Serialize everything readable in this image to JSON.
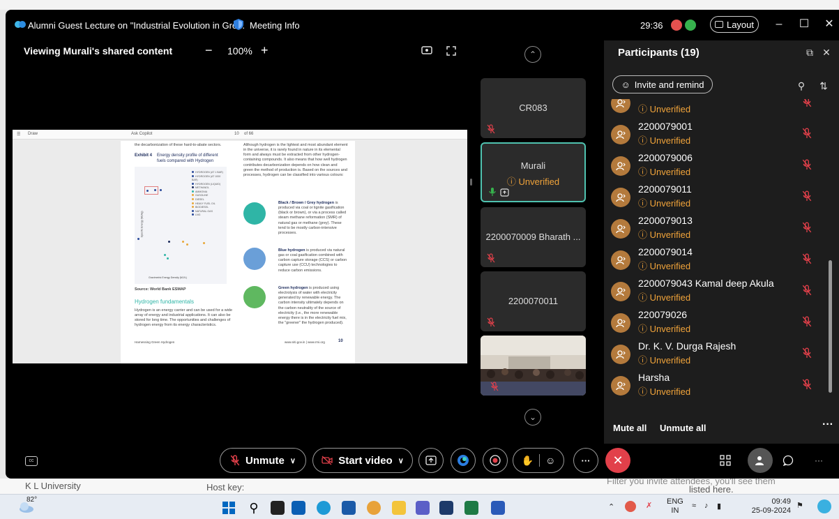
{
  "background": {
    "org_text": "K L University",
    "host_key": "Host key:",
    "listed": "listed here.",
    "filter": "Filter you invite attendees, you'll see them"
  },
  "titlebar": {
    "title": "Alumni Guest Lecture on \"Industrial Evolution in Gre...",
    "meeting_info": "Meeting Info",
    "timer": "29:36",
    "layout_label": "Layout"
  },
  "share": {
    "viewing": "Viewing Murali's shared content",
    "zoom_minus": "−",
    "zoom": "100%",
    "zoom_plus": "+"
  },
  "document": {
    "toolbar": {
      "draw": "Draw",
      "ask": "Ask Copilot",
      "page": "10",
      "of": "of 66"
    },
    "exhibit_label": "Exhibit 4",
    "exhibit_title": "Energy density profile of different fuels compared with Hydrogen",
    "source": "Source: World Bank ESMAP",
    "section_heading": "Hydrogen fundamentals",
    "para1": "Hydrogen is an energy carrier and can be used for a wide array of energy and industrial applications. It can also be stored for long time. The opportunities and challenges of hydrogen energy from its energy characteristics.",
    "intro": "Although hydrogen is the lightest and most abundant element in the universe, it is rarely found in nature in its elemental form and always must be extracted from other hydrogen-containing compounds. It also means that how well hydrogen contributes decarbonization depends on how clean and green the method of production is. Based on the sources and processes, hydrogen can be classified into various colours:",
    "black_title": "Black / Brown / Grey hydrogen",
    "black_text": "is produced via coal or lignite gasification (black or brown), or via a process called steam methane reformation (SMR) of natural gas or methane (grey). These tend to be mostly carbon-intensive processes.",
    "blue_title": "Blue hydrogen",
    "blue_text": "is produced via natural gas or coal gasification combined with carbon capture storage (CCS) or carbon capture use (CCU) technologies to reduce carbon emissions.",
    "green_title": "Green hydrogen",
    "green_text": "is produced using electrolysis of water with electricity generated by renewable energy. The carbon intensity ultimately depends on the carbon neutrality of the source of electricity (i.e., the more renewable energy there is in the electricity fuel mix, the \"greener\" the hydrogen produced).",
    "footer_left": "Harnessing Green Hydrogen",
    "footer_right": "www.niti.gov.in | www.rmi.org",
    "footer_page": "10",
    "top_text": "the decarbonization of these hard-to-abate sectors.",
    "legend": [
      "HYDROGEN (AT 1 BAR)",
      "HYDROGEN (AT 1000 BAR)",
      "HYDROGEN (LIQUID)",
      "METHANOL",
      "AMMONIA",
      "GASOLINE",
      "DIESEL",
      "HEAVY FUEL OIL",
      "BIODIESEL",
      "NATURAL GAS",
      "LNG"
    ],
    "xaxis": "Gravimetric Energy Density (MJ/L)",
    "yaxis": "Specific Energy (MJ/kg)",
    "colors": {
      "navy": "#1b2a5a",
      "teal": "#2fb5a6",
      "orange": "#e8a83a"
    }
  },
  "tiles": [
    {
      "name": "CR083",
      "muted": true
    },
    {
      "name": "Murali",
      "status": "ⓘ Unverified",
      "active": true
    },
    {
      "name": "2200070009 Bharath ...",
      "muted": true
    },
    {
      "name": "2200070011",
      "muted": true
    }
  ],
  "participants": {
    "title": "Participants (19)",
    "invite": "Invite and remind",
    "list": [
      {
        "name": "",
        "status": "ⓘ Unverified"
      },
      {
        "name": "2200079001",
        "status": "ⓘ Unverified"
      },
      {
        "name": "2200079006",
        "status": "ⓘ Unverified"
      },
      {
        "name": "2200079011",
        "status": "ⓘ Unverified"
      },
      {
        "name": "2200079013",
        "status": "ⓘ Unverified"
      },
      {
        "name": "2200079014",
        "status": "ⓘ Unverified"
      },
      {
        "name": "2200079043 Kamal deep Akula",
        "status": "ⓘ Unverified"
      },
      {
        "name": "220079026",
        "status": "ⓘ Unverified"
      },
      {
        "name": "Dr. K. V. Durga Rajesh",
        "status": "ⓘ Unverified"
      },
      {
        "name": "Harsha",
        "status": "ⓘ Unverified"
      }
    ],
    "mute_all": "Mute all",
    "unmute_all": "Unmute all"
  },
  "controls": {
    "unmute": "Unmute",
    "start_video": "Start video",
    "more": "···"
  },
  "taskbar": {
    "weather": "82°",
    "lang1": "ENG",
    "lang2": "IN",
    "time": "09:49",
    "date": "25-09-2024"
  }
}
